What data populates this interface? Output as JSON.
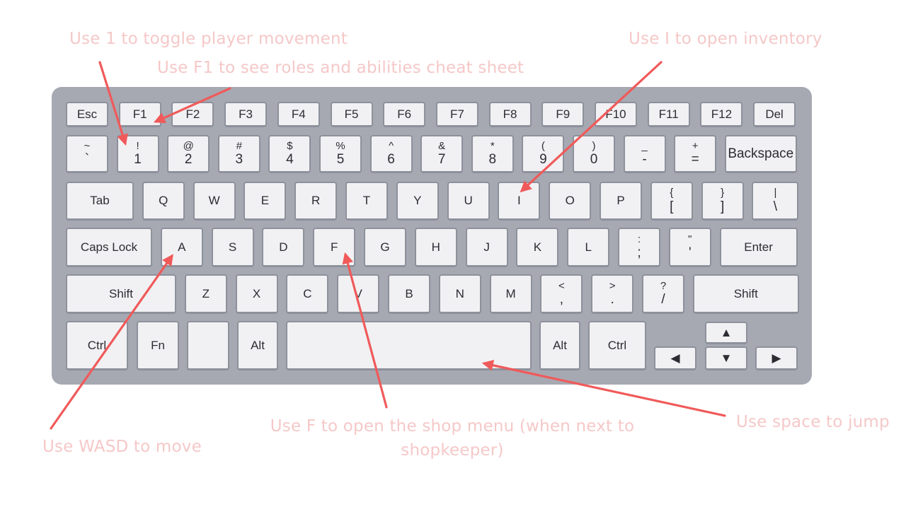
{
  "annotations": {
    "toggle_movement": "Use 1 to toggle player movement",
    "cheat_sheet": "Use F1 to see roles and abilities cheat sheet",
    "inventory": "Use I to open inventory",
    "move": "Use WASD to move",
    "shop": "Use F to open the shop menu (when next to shopkeeper)",
    "jump": "Use space to jump"
  },
  "colors": {
    "arrow": "#f05a5a",
    "annotation_text": "#f5c8c8",
    "keyboard_body": "#a6a9b2",
    "key_face": "#f1f1f3"
  },
  "keyboard": {
    "row_function": [
      "Esc",
      "F1",
      "F2",
      "F3",
      "F4",
      "F5",
      "F6",
      "F7",
      "F8",
      "F9",
      "F10",
      "F11",
      "F12",
      "Del"
    ],
    "row_number": [
      {
        "top": "~",
        "bottom": "`"
      },
      {
        "top": "!",
        "bottom": "1"
      },
      {
        "top": "@",
        "bottom": "2"
      },
      {
        "top": "#",
        "bottom": "3"
      },
      {
        "top": "$",
        "bottom": "4"
      },
      {
        "top": "%",
        "bottom": "5"
      },
      {
        "top": "^",
        "bottom": "6"
      },
      {
        "top": "&",
        "bottom": "7"
      },
      {
        "top": "*",
        "bottom": "8"
      },
      {
        "top": "(",
        "bottom": "9"
      },
      {
        "top": ")",
        "bottom": "0"
      },
      {
        "top": "_",
        "bottom": "-"
      },
      {
        "top": "+",
        "bottom": "="
      },
      {
        "top": "",
        "bottom": "Backspace"
      }
    ],
    "row_qwerty": [
      "Tab",
      "Q",
      "W",
      "E",
      "R",
      "T",
      "Y",
      "U",
      "I",
      "O",
      "P",
      {
        "top": "{",
        "bottom": "["
      },
      {
        "top": "}",
        "bottom": "]"
      },
      {
        "top": "|",
        "bottom": "\\"
      }
    ],
    "row_home": [
      "Caps Lock",
      "A",
      "S",
      "D",
      "F",
      "G",
      "H",
      "J",
      "K",
      "L",
      {
        "top": ":",
        "bottom": ";"
      },
      {
        "top": "\"",
        "bottom": "'"
      },
      "Enter"
    ],
    "row_shift": [
      "Shift",
      "Z",
      "X",
      "C",
      "V",
      "B",
      "N",
      "M",
      {
        "top": "<",
        "bottom": ","
      },
      {
        "top": ">",
        "bottom": "."
      },
      {
        "top": "?",
        "bottom": "/"
      },
      "Shift"
    ],
    "row_bottom": [
      "Ctrl",
      "Fn",
      "",
      "Alt",
      "",
      "Alt",
      "Ctrl"
    ],
    "arrows": {
      "up": "▲",
      "left": "◀",
      "down": "▼",
      "right": "▶"
    }
  }
}
